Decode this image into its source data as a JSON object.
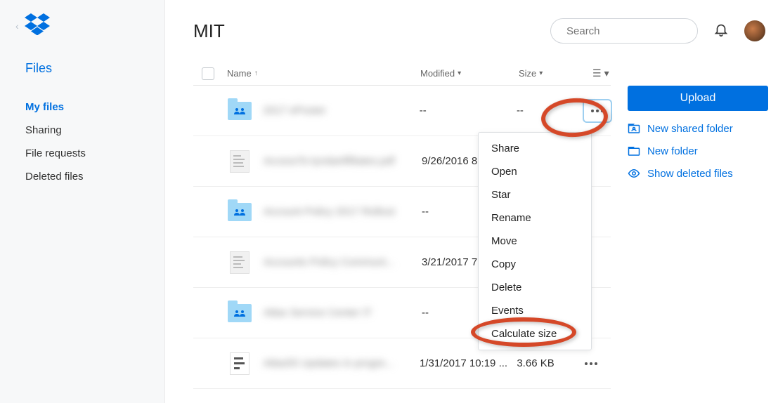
{
  "page_title": "MIT",
  "search": {
    "placeholder": "Search"
  },
  "sidebar": {
    "heading": "Files",
    "items": [
      {
        "label": "My files",
        "active": true
      },
      {
        "label": "Sharing"
      },
      {
        "label": "File requests"
      },
      {
        "label": "Deleted files"
      }
    ]
  },
  "columns": {
    "name": "Name",
    "modified": "Modified",
    "size": "Size"
  },
  "files": [
    {
      "name": "2017 ePoster",
      "type": "folder",
      "modified": "--",
      "size": "--",
      "actions_open": true
    },
    {
      "name": "AccessTo-lyndaAffiliates.pdf",
      "type": "doc",
      "modified": "9/26/2016 8:13 ...",
      "size": ""
    },
    {
      "name": "Account Policy 2017 Rollout",
      "type": "folder",
      "modified": "--",
      "size": ""
    },
    {
      "name": "Accounts Policy Communi...",
      "type": "doc",
      "modified": "3/21/2017 7:22 ...",
      "size": ""
    },
    {
      "name": "Atlas Service Center IT",
      "type": "folder",
      "modified": "--",
      "size": ""
    },
    {
      "name": "Atlas55 Updates in progre...",
      "type": "paper",
      "modified": "1/31/2017 10:19 ...",
      "size": "3.66 KB",
      "more_plain": true
    }
  ],
  "context_menu": [
    "Share",
    "Open",
    "Star",
    "Rename",
    "Move",
    "Copy",
    "Delete",
    "Events",
    "Calculate size"
  ],
  "actions": {
    "upload": "Upload",
    "links": [
      {
        "label": "New shared folder",
        "icon": "shared-folder"
      },
      {
        "label": "New folder",
        "icon": "folder"
      },
      {
        "label": "Show deleted files",
        "icon": "eye"
      }
    ]
  }
}
